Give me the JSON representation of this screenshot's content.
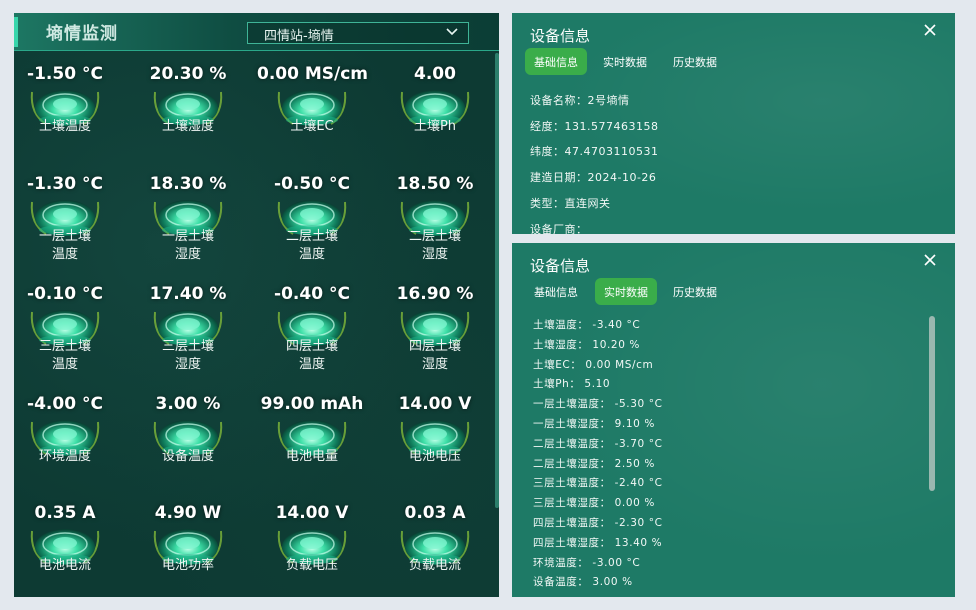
{
  "left": {
    "title": "墒情监测",
    "station": "四情站-墒情",
    "items": [
      {
        "value": "-1.50 °C",
        "label1": "土壤温度",
        "label2": ""
      },
      {
        "value": "20.30 %",
        "label1": "土壤湿度",
        "label2": ""
      },
      {
        "value": "0.00 MS/cm",
        "label1": "土壤EC",
        "label2": ""
      },
      {
        "value": "4.00",
        "label1": "土壤Ph",
        "label2": ""
      },
      {
        "value": "-1.30 °C",
        "label1": "一层土壤",
        "label2": "温度"
      },
      {
        "value": "18.30 %",
        "label1": "一层土壤",
        "label2": "湿度"
      },
      {
        "value": "-0.50 °C",
        "label1": "二层土壤",
        "label2": "温度"
      },
      {
        "value": "18.50 %",
        "label1": "二层土壤",
        "label2": "湿度"
      },
      {
        "value": "-0.10 °C",
        "label1": "三层土壤",
        "label2": "温度"
      },
      {
        "value": "17.40 %",
        "label1": "三层土壤",
        "label2": "湿度"
      },
      {
        "value": "-0.40 °C",
        "label1": "四层土壤",
        "label2": "温度"
      },
      {
        "value": "16.90 %",
        "label1": "四层土壤",
        "label2": "湿度"
      },
      {
        "value": "-4.00 °C",
        "label1": "环境温度",
        "label2": ""
      },
      {
        "value": "3.00 %",
        "label1": "设备温度",
        "label2": ""
      },
      {
        "value": "99.00 mAh",
        "label1": "电池电量",
        "label2": ""
      },
      {
        "value": "14.00 V",
        "label1": "电池电压",
        "label2": ""
      },
      {
        "value": "0.35 A",
        "label1": "电池电流",
        "label2": ""
      },
      {
        "value": "4.90 W",
        "label1": "电池功率",
        "label2": ""
      },
      {
        "value": "14.00 V",
        "label1": "负载电压",
        "label2": ""
      },
      {
        "value": "0.03 A",
        "label1": "负载电流",
        "label2": ""
      }
    ]
  },
  "card1": {
    "title": "设备信息",
    "tabs": [
      "基础信息",
      "实时数据",
      "历史数据"
    ],
    "active_tab": 0,
    "lines": [
      "设备名称：2号墒情",
      "经度：131.577463158",
      "纬度：47.4703110531",
      "建造日期：2024-10-26",
      "类型：直连网关",
      "设备厂商："
    ]
  },
  "card2": {
    "title": "设备信息",
    "tabs": [
      "基础信息",
      "实时数据",
      "历史数据"
    ],
    "active_tab": 1,
    "lines": [
      "土壤温度： -3.40 °C",
      "土壤湿度： 10.20 %",
      "土壤EC： 0.00 MS/cm",
      "土壤Ph： 5.10",
      "一层土壤温度： -5.30 °C",
      "一层土壤湿度： 9.10 %",
      "二层土壤温度： -3.70 °C",
      "二层土壤湿度： 2.50 %",
      "三层土壤温度： -2.40 °C",
      "三层土壤湿度： 0.00 %",
      "四层土壤温度： -2.30 °C",
      "四层土壤湿度： 13.40 %",
      "环境温度： -3.00 °C",
      "设备温度： 3.00 %"
    ]
  },
  "colors": {
    "panel_bg": "#0d3a33",
    "card_bg": "#1e7a66",
    "accent": "#38d6ab",
    "tab_active": "#3aad4a"
  },
  "icons": {
    "gauge": "glowing-gauge-icon",
    "close": "close-icon",
    "dropdown": "chevron-down-icon"
  }
}
